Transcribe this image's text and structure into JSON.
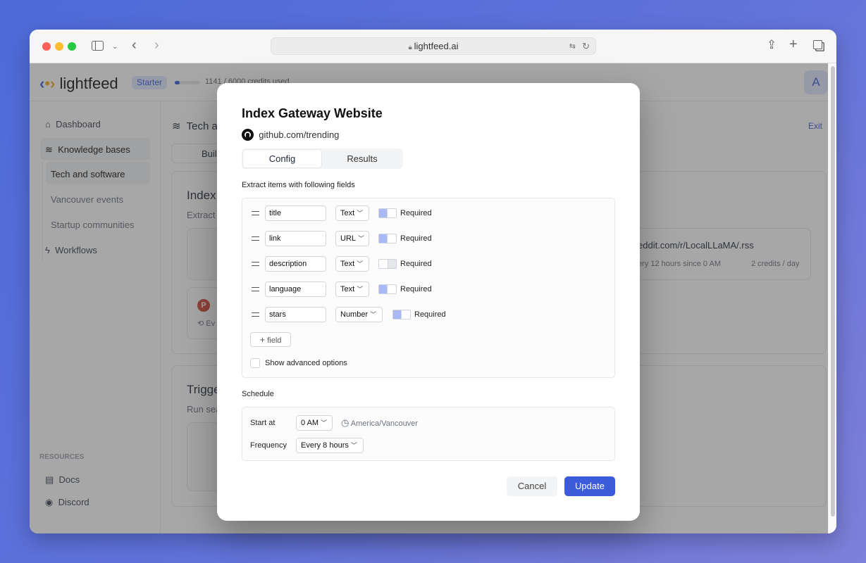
{
  "browser": {
    "url": "lightfeed.ai",
    "icons": [
      "close-dot",
      "minimize-dot",
      "zoom-dot",
      "sidebar-icon",
      "chevron-down-icon",
      "back-icon",
      "forward-icon",
      "lock-icon",
      "translate-icon",
      "reload-icon",
      "share-icon",
      "new-tab-icon",
      "tabs-icon"
    ],
    "colors": {
      "close": "#ff5f57",
      "minimize": "#febc2e",
      "zoom": "#28c840"
    }
  },
  "header": {
    "logo": "lightfeed",
    "plan_badge": "Starter",
    "credits_text": "1141 / 6000 credits used",
    "credits_used": 1141,
    "credits_total": 6000,
    "avatar": "A"
  },
  "sidebar": {
    "items": [
      {
        "label": "Dashboard",
        "icon": "home-icon"
      },
      {
        "label": "Knowledge bases",
        "icon": "layers-icon"
      },
      {
        "label": "Tech and software"
      },
      {
        "label": "Vancouver events"
      },
      {
        "label": "Startup communities"
      },
      {
        "label": "Workflows",
        "icon": "bolt-icon"
      }
    ],
    "resources_heading": "RESOURCES",
    "resources": [
      {
        "label": "Docs",
        "icon": "doc-icon"
      },
      {
        "label": "Discord",
        "icon": "discord-icon"
      }
    ]
  },
  "main": {
    "breadcrumb": "Tech a",
    "exit": "Exit",
    "tab": "Buil",
    "card1_title": "Index",
    "card1_sub": "Extract",
    "feed_url": "eddit.com/r/LocalLLaMA/.rss",
    "feed_schedule": "ery 12 hours since 0 AM",
    "feed_credits": "2 credits / day",
    "item_avatar": "P",
    "item_meta": "Ev",
    "card2_title": "Trigge",
    "card2_sub": "Run sea"
  },
  "modal": {
    "title": "Index Gateway Website",
    "source": "github.com/trending",
    "tabs": [
      {
        "label": "Config",
        "active": true
      },
      {
        "label": "Results",
        "active": false
      }
    ],
    "fields_heading": "Extract items with following fields",
    "fields": [
      {
        "name": "title",
        "type": "Text",
        "required": true,
        "required_label": "Required"
      },
      {
        "name": "link",
        "type": "URL",
        "required": true,
        "required_label": "Required"
      },
      {
        "name": "description",
        "type": "Text",
        "required": false,
        "required_label": "Required"
      },
      {
        "name": "language",
        "type": "Text",
        "required": true,
        "required_label": "Required"
      },
      {
        "name": "stars",
        "type": "Number",
        "required": true,
        "required_label": "Required"
      }
    ],
    "add_field": "field",
    "advanced_label": "Show advanced options",
    "advanced_checked": false,
    "schedule_heading": "Schedule",
    "start_at_label": "Start at",
    "start_at_value": "0 AM",
    "timezone": "America/Vancouver",
    "frequency_label": "Frequency",
    "frequency_value": "Every 8 hours",
    "cancel": "Cancel",
    "update": "Update",
    "accent": "#3b5bdb"
  }
}
